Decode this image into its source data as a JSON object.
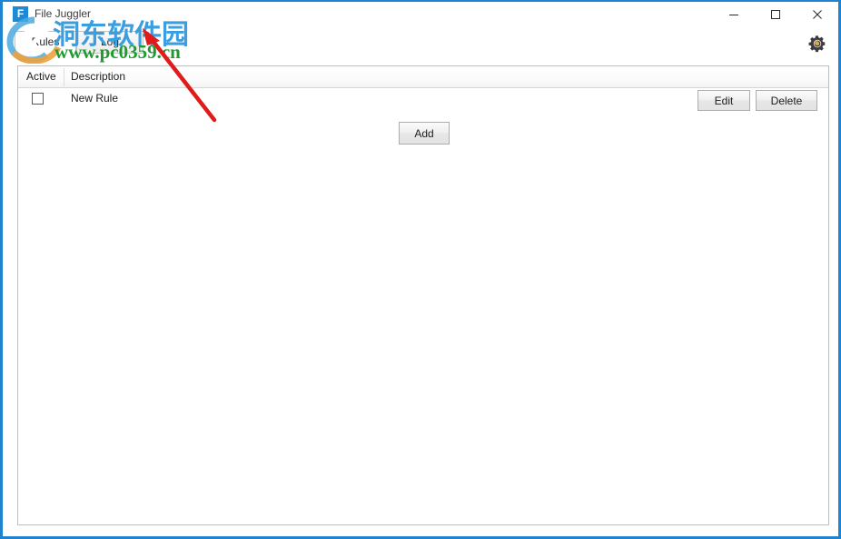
{
  "window": {
    "title": "File Juggler",
    "icon_letter": "F",
    "icon_name": "app-icon-file-juggler",
    "controls": {
      "minimize_label": "Minimize",
      "maximize_label": "Maximize",
      "close_label": "Close"
    }
  },
  "tabs": [
    {
      "label": "Rules",
      "selected": true
    },
    {
      "label": "Log",
      "selected": false
    }
  ],
  "toolbar": {
    "settings_icon": "gear-icon",
    "settings_label": "Settings"
  },
  "rules_table": {
    "columns": [
      "Active",
      "Description"
    ],
    "rows": [
      {
        "active": false,
        "description": "New Rule",
        "edit_label": "Edit",
        "delete_label": "Delete"
      }
    ],
    "add_label": "Add"
  },
  "watermark": {
    "cn_text": "洞东软件园",
    "url_text": "www.pc0359.cn",
    "cn_color": "#3b9ee0",
    "url_color": "#1e9b2e",
    "logo_color": "#3b9ee0",
    "logo_accent_color": "#f0a13c",
    "arrow_color": "#e01b1b"
  },
  "colors": {
    "window_border": "#1e84cf",
    "accent": "#1e8ad6",
    "panel_border": "#bfbfbf",
    "button_border": "#adadad"
  }
}
